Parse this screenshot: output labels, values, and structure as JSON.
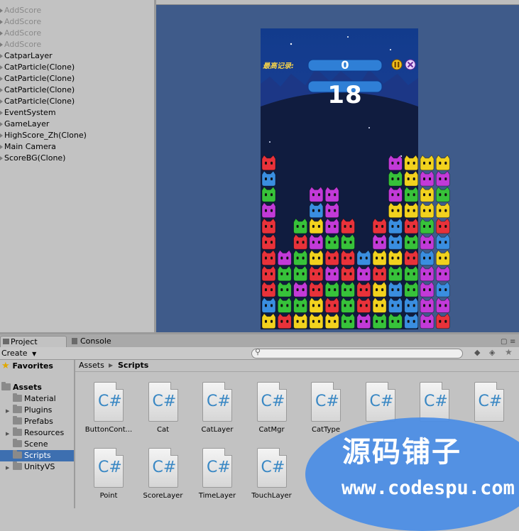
{
  "hierarchy": {
    "items": [
      {
        "label": "AddScore",
        "dim": true
      },
      {
        "label": "AddScore",
        "dim": true
      },
      {
        "label": "AddScore",
        "dim": true
      },
      {
        "label": "AddScore",
        "dim": true
      },
      {
        "label": "CatparLayer",
        "dim": false
      },
      {
        "label": "CatParticle(Clone)",
        "dim": false
      },
      {
        "label": "CatParticle(Clone)",
        "dim": false
      },
      {
        "label": "CatParticle(Clone)",
        "dim": false
      },
      {
        "label": "CatParticle(Clone)",
        "dim": false
      },
      {
        "label": "EventSystem",
        "dim": false
      },
      {
        "label": "GameLayer",
        "dim": false
      },
      {
        "label": "HighScore_Zh(Clone)",
        "dim": false
      },
      {
        "label": "Main Camera",
        "dim": false
      },
      {
        "label": "ScoreBG(Clone)",
        "dim": false
      }
    ]
  },
  "game": {
    "high_score_label": "最高记录:",
    "high_score_value": "0",
    "current_score": "18",
    "pause_icon": "pause-icon",
    "close_icon": "close-icon",
    "colors": {
      "red": "#e8323a",
      "blue": "#3a8ee0",
      "green": "#37c23a",
      "purple": "#c23ad8",
      "yellow": "#f2d21e"
    }
  },
  "tabs": {
    "project": "Project",
    "console": "Console"
  },
  "toolbar": {
    "create": "Create"
  },
  "tree": {
    "favorites": "Favorites",
    "assets": "Assets",
    "folders": [
      "Material",
      "Plugins",
      "Prefabs",
      "Resources",
      "Scene",
      "Scripts",
      "UnityVS"
    ],
    "selected": "Scripts"
  },
  "breadcrumb": {
    "root": "Assets",
    "current": "Scripts"
  },
  "files": [
    "ButtonCont...",
    "Cat",
    "CatLayer",
    "CatMgr",
    "CatType",
    "",
    "",
    "",
    "Point",
    "ScoreLayer",
    "TimeLayer",
    "TouchLayer"
  ],
  "watermark": {
    "line1": "源码铺子",
    "line2": "www.codespu.com"
  }
}
